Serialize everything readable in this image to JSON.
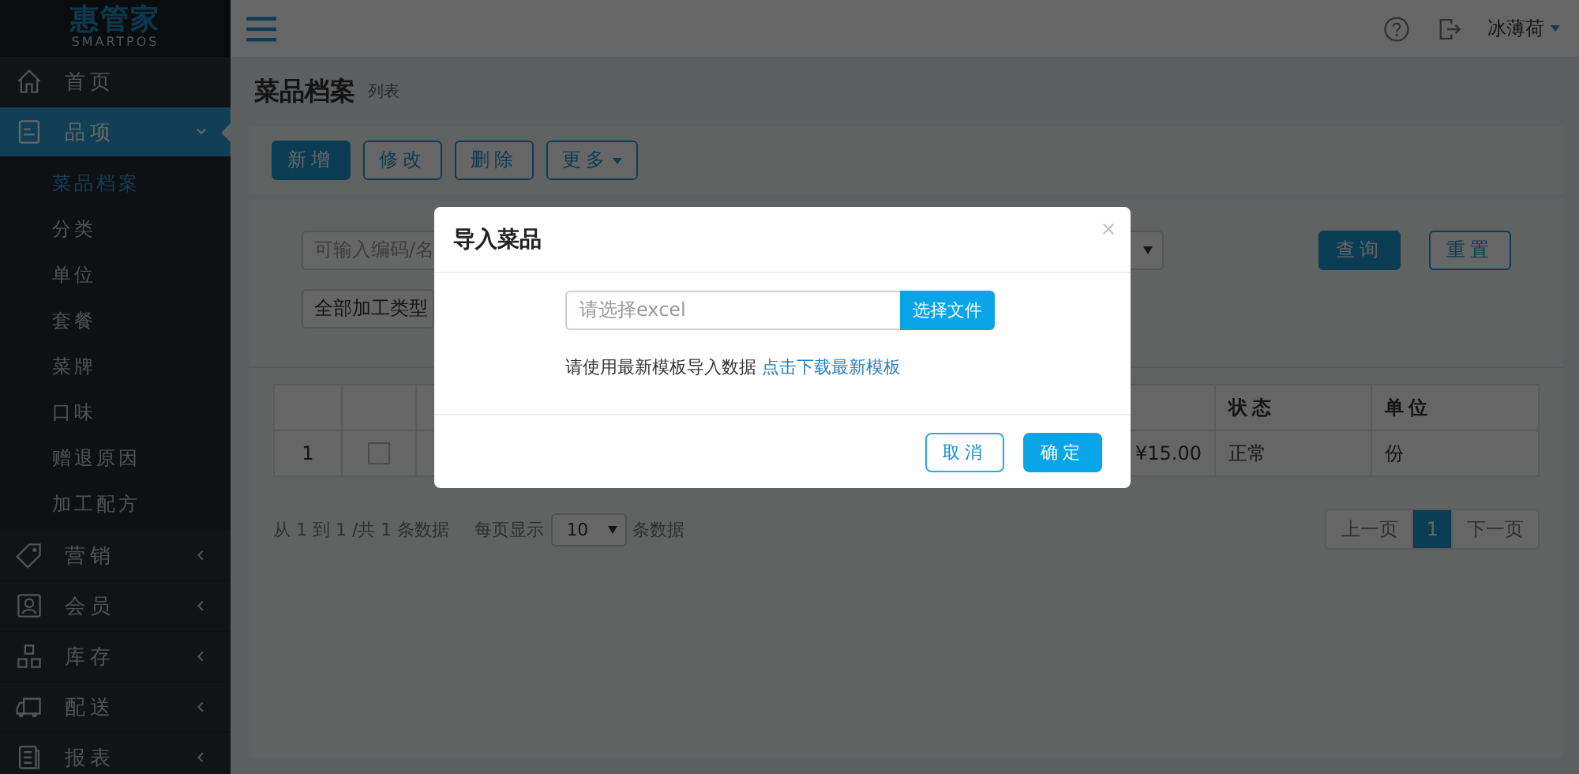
{
  "sidebar": {
    "logo": {
      "name": "惠管家",
      "tagline": "SMARTPOS"
    },
    "items": [
      {
        "label": "首页",
        "selected": false
      },
      {
        "label": "品项",
        "selected": true,
        "expanded": true,
        "children": [
          {
            "label": "菜品档案",
            "selected": true
          },
          {
            "label": "分类",
            "selected": false
          },
          {
            "label": "单位",
            "selected": false
          },
          {
            "label": "套餐",
            "selected": false
          },
          {
            "label": "菜牌",
            "selected": false
          },
          {
            "label": "口味",
            "selected": false
          },
          {
            "label": "赠退原因",
            "selected": false
          },
          {
            "label": "加工配方",
            "selected": false
          }
        ]
      },
      {
        "label": "营销",
        "selected": false,
        "expanded": false
      },
      {
        "label": "会员",
        "selected": false,
        "expanded": false
      },
      {
        "label": "库存",
        "selected": false,
        "expanded": false
      },
      {
        "label": "配送",
        "selected": false,
        "expanded": false
      },
      {
        "label": "报表",
        "selected": false,
        "expanded": false
      }
    ]
  },
  "header": {
    "user": "冰薄荷"
  },
  "page": {
    "title": "菜品档案",
    "subtitle": "列表"
  },
  "toolbar": [
    {
      "label": "新增",
      "kind": "primary"
    },
    {
      "label": "修改",
      "kind": "outline"
    },
    {
      "label": "删除",
      "kind": "outline"
    },
    {
      "label": "更多",
      "kind": "dropdown"
    }
  ],
  "filters": {
    "search_placeholder": "可输入编码/名",
    "process_type": "全部加工类型",
    "buttons": [
      {
        "label": "查询",
        "kind": "primary"
      },
      {
        "label": "重置",
        "kind": "outline"
      }
    ]
  },
  "table": {
    "columns": [
      {
        "label": "状态"
      },
      {
        "label": "单位"
      }
    ],
    "rows": [
      {
        "index": "1",
        "checked": false,
        "price": "¥15.00",
        "status": "正常",
        "unit": "份"
      }
    ]
  },
  "pagination": {
    "summary": "从 1 到 1 /共 1 条数据",
    "per_page_label": "每页显示",
    "per_page": "10",
    "per_page_suffix": "条数据",
    "pages": [
      {
        "label": "上一页",
        "selected": false
      },
      {
        "label": "1",
        "selected": true
      },
      {
        "label": "下一页",
        "selected": false
      }
    ]
  },
  "dialog": {
    "title": "导入菜品",
    "file_placeholder": "请选择excel",
    "choose_button": "选择文件",
    "hint": "请使用最新模板导入数据",
    "link": "点击下载最新模板",
    "buttons": [
      {
        "label": "取消",
        "kind": "outline"
      },
      {
        "label": "确定",
        "kind": "primary"
      }
    ]
  }
}
